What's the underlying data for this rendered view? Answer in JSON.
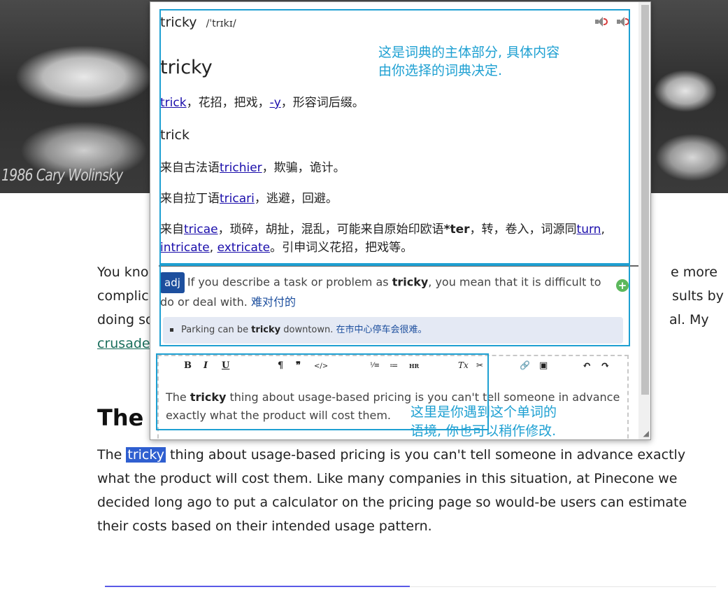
{
  "hero": {
    "credit": "1986 Cary Wolinsky"
  },
  "article": {
    "para1_lines": [
      "You kno",
      "complic",
      "doing so",
      "crusade"
    ],
    "para1_right": [
      "e more",
      "sults by",
      "al. My"
    ],
    "heading": "The c",
    "para2": {
      "before": "The ",
      "highlight": "tricky",
      "line1_rest": " thing about usage-based pricing is you can't tell someone in advance exactly",
      "line2": "what the product will cost them. Like many companies in this situation, at Pinecone we",
      "line3": "decided long ago to put a calculator on the pricing page so would-be users can estimate",
      "line4": "their costs based on their intended usage pattern."
    }
  },
  "popup": {
    "headword": "tricky",
    "ipa": "/ˈtrɪkɪ/",
    "speakers": [
      "speaker-uk-icon",
      "speaker-us-icon"
    ],
    "entry_title": "tricky",
    "etym_line1": {
      "link1": "trick",
      "mid": "，花招，把戏，",
      "link2": "-y",
      "end": "，形容词后缀。"
    },
    "sub_headword": "trick",
    "etym_line2": {
      "pre": "来自古法语",
      "link": "trichier",
      "end": "，欺骗，诡计。"
    },
    "etym_line3": {
      "pre": "来自拉丁语",
      "link": "tricari",
      "end": "，逃避，回避。"
    },
    "etym_line4": {
      "pre": "来自",
      "link": "tricae",
      "mid": "，琐碎，胡扯，混乱，可能来自原始印欧语",
      "bold": "*ter",
      "mid2": "，转，卷入，词源同",
      "link2": "turn",
      "comma": ","
    },
    "etym_line5": {
      "link1": "intricate",
      "comma": ", ",
      "link2": "extricate",
      "end": "。引申词义花招，把戏等。"
    },
    "collins": {
      "pos": "adj",
      "def_pre": "If you describe a task or problem as ",
      "def_bold": "tricky",
      "def_post": ", you mean that it is difficult to",
      "def_line2": "do or deal with. ",
      "def_cn": "难对付的",
      "example_pre": "Parking can be ",
      "example_bold": "tricky",
      "example_post": " downtown. ",
      "example_cn": "在市中心停车会很难。"
    },
    "toolbar": {
      "bold": "B",
      "italic": "I",
      "underline": "U",
      "paragraph": "¶",
      "quote": "❞",
      "code": "</>",
      "ordered_list": "⅟≡",
      "bullet_list": "≔",
      "hr": "HR",
      "clear_format": "Tx",
      "unlink": "✂",
      "link": "🔗",
      "image": "▣",
      "undo": "↶",
      "redo": "↷"
    },
    "editor": {
      "pre": "The ",
      "bold": "tricky",
      "post": " thing about usage-based pricing is you can't tell someone in advance",
      "line2": "exactly what the product will cost them."
    }
  },
  "annotations": {
    "top_line1": "这是词典的主体部分, 具体内容",
    "top_line2": "由你选择的词典决定.",
    "bottom_line1": "这里是你遇到这个单词的",
    "bottom_line2": "语境, 你也可以稍作修改.",
    "color": "#1ea0d2"
  }
}
